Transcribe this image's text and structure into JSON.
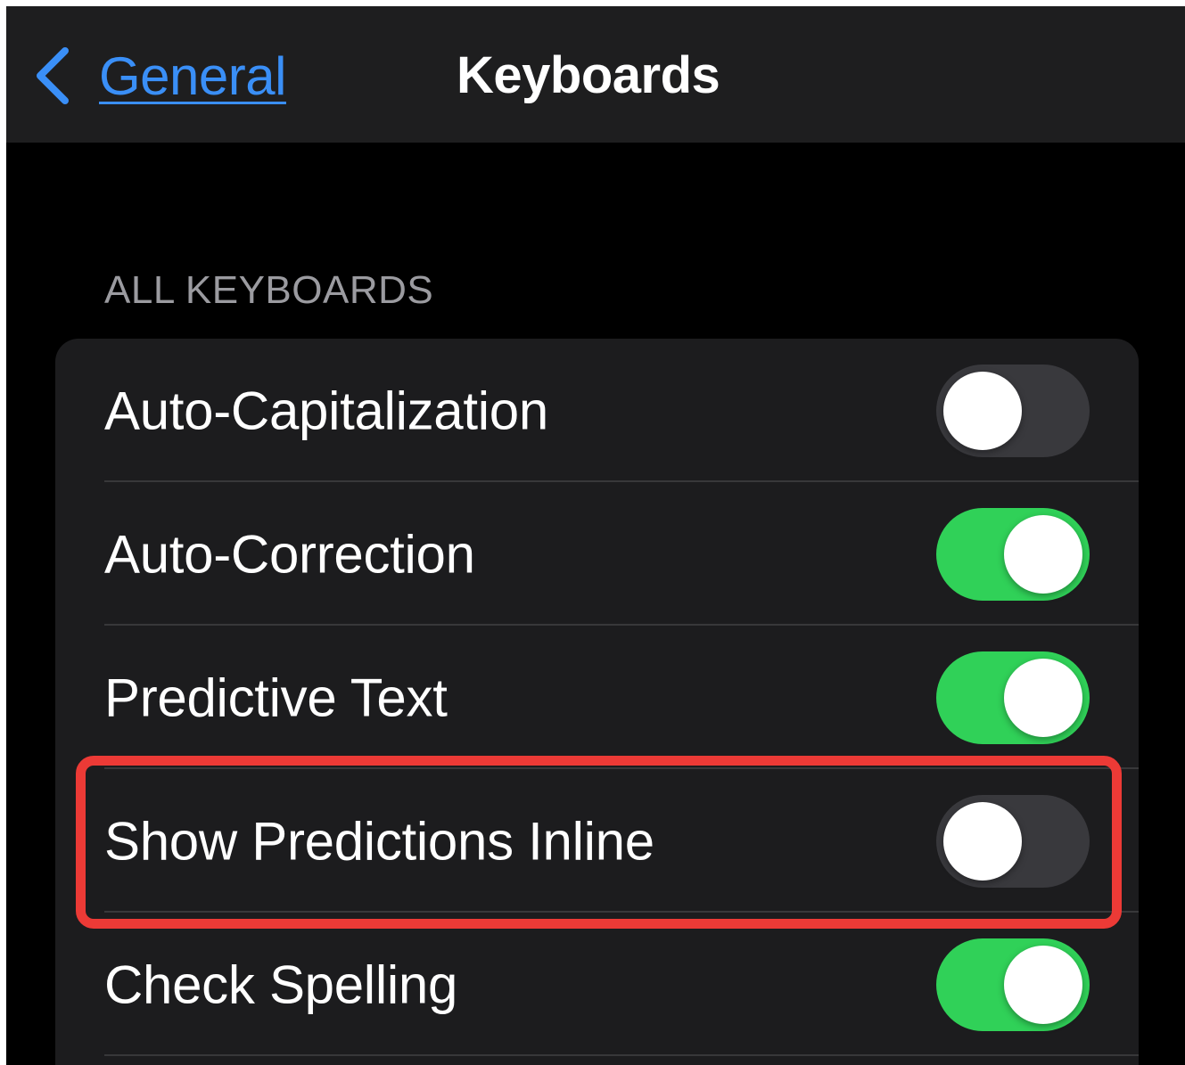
{
  "navbar": {
    "back_label": "General",
    "title": "Keyboards",
    "back_icon": "chevron-left-icon"
  },
  "section": {
    "header": "ALL KEYBOARDS"
  },
  "settings": [
    {
      "label": "Auto-Capitalization",
      "on": false
    },
    {
      "label": "Auto-Correction",
      "on": true
    },
    {
      "label": "Predictive Text",
      "on": true
    },
    {
      "label": "Show Predictions Inline",
      "on": false,
      "highlighted": true
    },
    {
      "label": "Check Spelling",
      "on": true
    }
  ],
  "colors": {
    "accent": "#3a8ff7",
    "toggle_on": "#30d158",
    "toggle_off": "#39393d",
    "highlight": "#ec3a36"
  }
}
